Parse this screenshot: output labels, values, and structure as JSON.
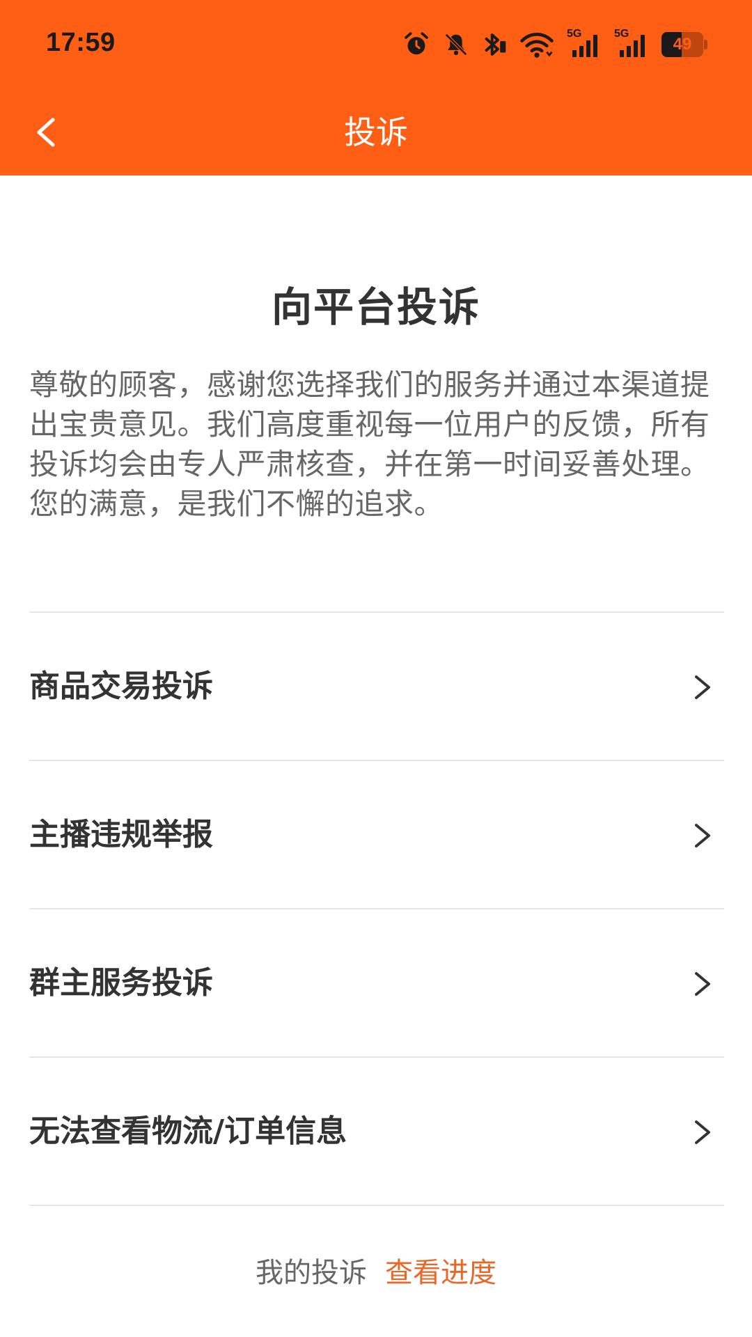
{
  "status_bar": {
    "time": "17:59",
    "battery_level": "49",
    "battery_fraction": 0.49,
    "network_label_1": "5G",
    "network_label_2": "5G",
    "icons": [
      "alarm-icon",
      "mute-icon",
      "bluetooth-icon",
      "wifi-icon",
      "signal-icon",
      "signal-icon",
      "battery-icon"
    ]
  },
  "nav": {
    "title": "投诉",
    "back_icon": "chevron-left-icon"
  },
  "main": {
    "title": "向平台投诉",
    "intro": "尊敬的顾客，感谢您选择我们的服务并通过本渠道提出宝贵意见。我们高度重视每一位用户的反馈，所有投诉均会由专人严肃核查，并在第一时间妥善处理。您的满意，是我们不懈的追求。"
  },
  "menu": {
    "items": [
      {
        "label": "商品交易投诉"
      },
      {
        "label": "主播违规举报"
      },
      {
        "label": "群主服务投诉"
      },
      {
        "label": "无法查看物流/订单信息"
      }
    ]
  },
  "footer": {
    "label": "我的投诉",
    "link": "查看进度"
  },
  "colors": {
    "brand": "#FF5F15",
    "link": "#E8682A",
    "title_text": "#333333",
    "body_text": "#666666",
    "divider": "#E5E5E5"
  }
}
